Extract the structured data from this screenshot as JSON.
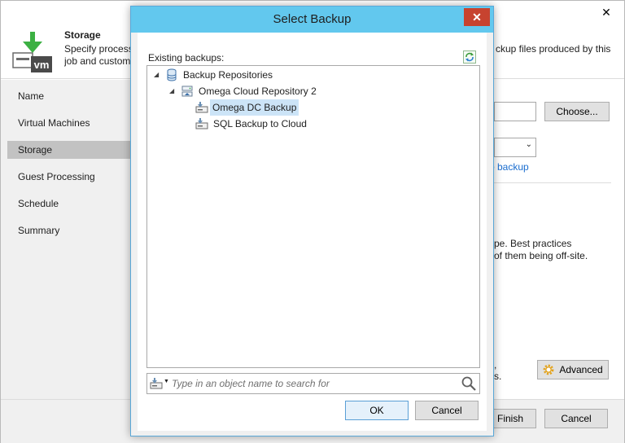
{
  "wizard": {
    "close_glyph": "✕",
    "header": {
      "title": "Storage",
      "desc_line1": "Specify processing",
      "desc_line2": "job and customize",
      "desc_right": "ckup files produced by this"
    },
    "nav": [
      {
        "label": "Name",
        "active": false
      },
      {
        "label": "Virtual Machines",
        "active": false
      },
      {
        "label": "Storage",
        "active": true
      },
      {
        "label": "Guest Processing",
        "active": false
      },
      {
        "label": "Schedule",
        "active": false
      },
      {
        "label": "Summary",
        "active": false
      }
    ],
    "content": {
      "choose_button": "Choose...",
      "backup_link": "o backup",
      "text_line1": "pe. Best practices",
      "text_line2": "of them being off-site.",
      "text_line3": ",",
      "text_line4": "s.",
      "advanced_button": "Advanced"
    },
    "footer": {
      "finish_button": "Finish",
      "cancel_button": "Cancel"
    }
  },
  "dialog": {
    "title": "Select Backup",
    "close_glyph": "✕",
    "existing_label": "Existing backups:",
    "tree": {
      "root": {
        "label": "Backup Repositories",
        "expanded": true
      },
      "repository": {
        "label": "Omega Cloud Repository 2",
        "expanded": true
      },
      "items": [
        {
          "label": "Omega DC Backup",
          "selected": true
        },
        {
          "label": "SQL Backup to Cloud",
          "selected": false
        }
      ]
    },
    "search": {
      "placeholder": "Type in an object name to search for",
      "value": ""
    },
    "ok_button": "OK",
    "cancel_button": "Cancel"
  },
  "colors": {
    "dialog_title_bg": "#62c8ee",
    "close_red": "#c7432f",
    "selection": "#cce4f7",
    "link": "#1a6dcf",
    "veeam_green": "#3cb043"
  }
}
